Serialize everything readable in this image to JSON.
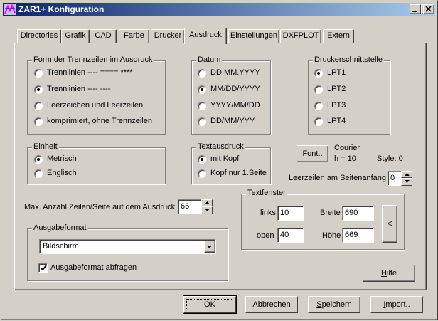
{
  "title": "ZAR1+ Konfiguration",
  "tabs": [
    "Directories",
    "Grafik",
    "CAD",
    "Farbe",
    "Drucker",
    "Ausdruck",
    "Einstellungen",
    "DXFPLOT",
    "Extern"
  ],
  "trenn": {
    "legend": "Form der Trennzeilen im Ausdruck",
    "options": [
      "Trennlinien  ---- ====  ****",
      "Trennlinien  ---- ----",
      "Leerzeichen und Leerzeilen",
      "komprimiert, ohne Trennzeilen"
    ]
  },
  "datum": {
    "legend": "Datum",
    "options": [
      "DD.MM.YYYY",
      "MM/DD/YYYY",
      "YYYY/MM/DD",
      "DD/MM/YYY"
    ]
  },
  "schnittstelle": {
    "legend": "Druckerschnittstelle",
    "options": [
      "LPT1",
      "LPT2",
      "LPT3",
      "LPT4"
    ]
  },
  "einheit": {
    "legend": "Einheit",
    "options": [
      "Metrisch",
      "Englisch"
    ]
  },
  "textausdruck": {
    "legend": "Textausdruck",
    "options": [
      "mit Kopf",
      "Kopf nur 1.Seite"
    ]
  },
  "font": {
    "button": "Font..",
    "name": "Courier",
    "height": "h = 10",
    "style": "Style:  0"
  },
  "leerzeilen": {
    "label": "Leerzeilen am Seitenanfang",
    "value": "0"
  },
  "max_zeilen": {
    "label": "Max. Anzahl Zeilen/Seite auf dem Ausdruck",
    "value": "66"
  },
  "textfenster": {
    "legend": "Textfenster",
    "links_label": "links",
    "links": "10",
    "oben_label": "oben",
    "oben": "40",
    "breite_label": "Breite",
    "breite": "690",
    "hoehe_label": "Höhe",
    "hoehe": "669",
    "arrow": "<"
  },
  "ausgabe": {
    "legend": "Ausgabeformat",
    "selected": "Bildschirm",
    "checkbox_label": "Ausgabeformat abfragen"
  },
  "hilfe": {
    "prefix": "",
    "ul": "H",
    "rest": "ilfe"
  },
  "buttons": {
    "ok": "OK",
    "abbrechen": "Abbrechen",
    "speichern_ul": "S",
    "speichern_rest": "peichern",
    "import_ul": "I",
    "import_rest": "mport.."
  }
}
